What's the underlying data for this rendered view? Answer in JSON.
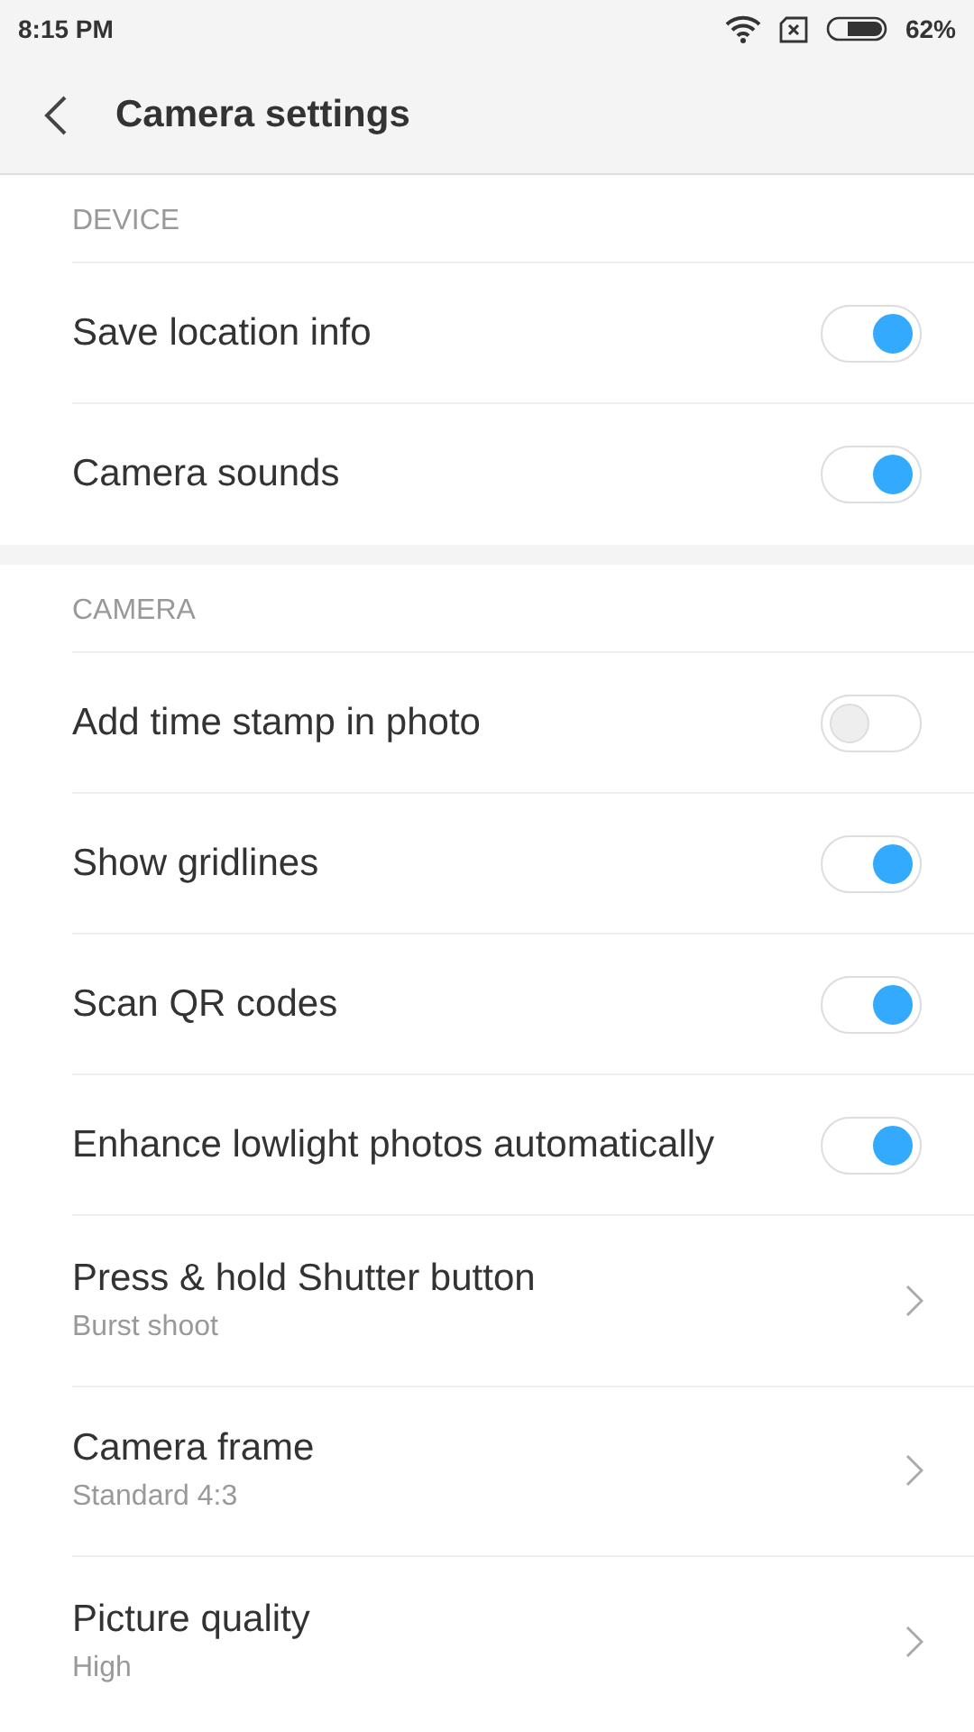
{
  "status_bar": {
    "time": "8:15 PM",
    "battery": "62%"
  },
  "header": {
    "title": "Camera settings"
  },
  "sections": [
    {
      "title": "DEVICE",
      "items": [
        {
          "kind": "toggle",
          "label": "Save location info",
          "on": true
        },
        {
          "kind": "toggle",
          "label": "Camera sounds",
          "on": true
        }
      ]
    },
    {
      "title": "CAMERA",
      "items": [
        {
          "kind": "toggle",
          "label": "Add time stamp in photo",
          "on": false
        },
        {
          "kind": "toggle",
          "label": "Show gridlines",
          "on": true
        },
        {
          "kind": "toggle",
          "label": "Scan QR codes",
          "on": true
        },
        {
          "kind": "toggle",
          "label": "Enhance lowlight photos automatically",
          "on": true
        },
        {
          "kind": "link",
          "label": "Press & hold Shutter button",
          "value": "Burst shoot"
        },
        {
          "kind": "link",
          "label": "Camera frame",
          "value": "Standard 4:3"
        },
        {
          "kind": "link",
          "label": "Picture quality",
          "value": "High"
        }
      ]
    }
  ]
}
